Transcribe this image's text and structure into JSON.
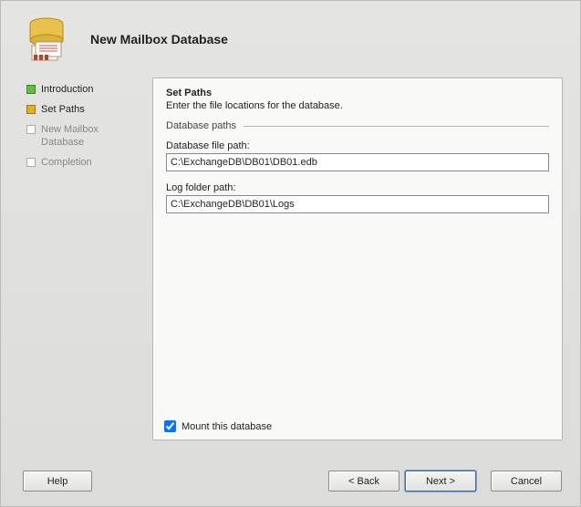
{
  "header": {
    "title": "New Mailbox Database"
  },
  "nav": {
    "items": [
      {
        "label": "Introduction",
        "state": "done"
      },
      {
        "label": "Set Paths",
        "state": "current"
      },
      {
        "label": "New Mailbox\nDatabase",
        "state": "pending"
      },
      {
        "label": "Completion",
        "state": "pending"
      }
    ]
  },
  "main": {
    "title": "Set Paths",
    "subtitle": "Enter the file locations for the database.",
    "group_label": "Database paths",
    "db_file_label": "Database file path:",
    "db_file_value": "C:\\ExchangeDB\\DB01\\DB01.edb",
    "log_folder_label": "Log folder path:",
    "log_folder_value": "C:\\ExchangeDB\\DB01\\Logs",
    "mount_label": "Mount this database",
    "mount_checked": true
  },
  "footer": {
    "help": "Help",
    "back": "< Back",
    "next": "Next >",
    "cancel": "Cancel"
  }
}
